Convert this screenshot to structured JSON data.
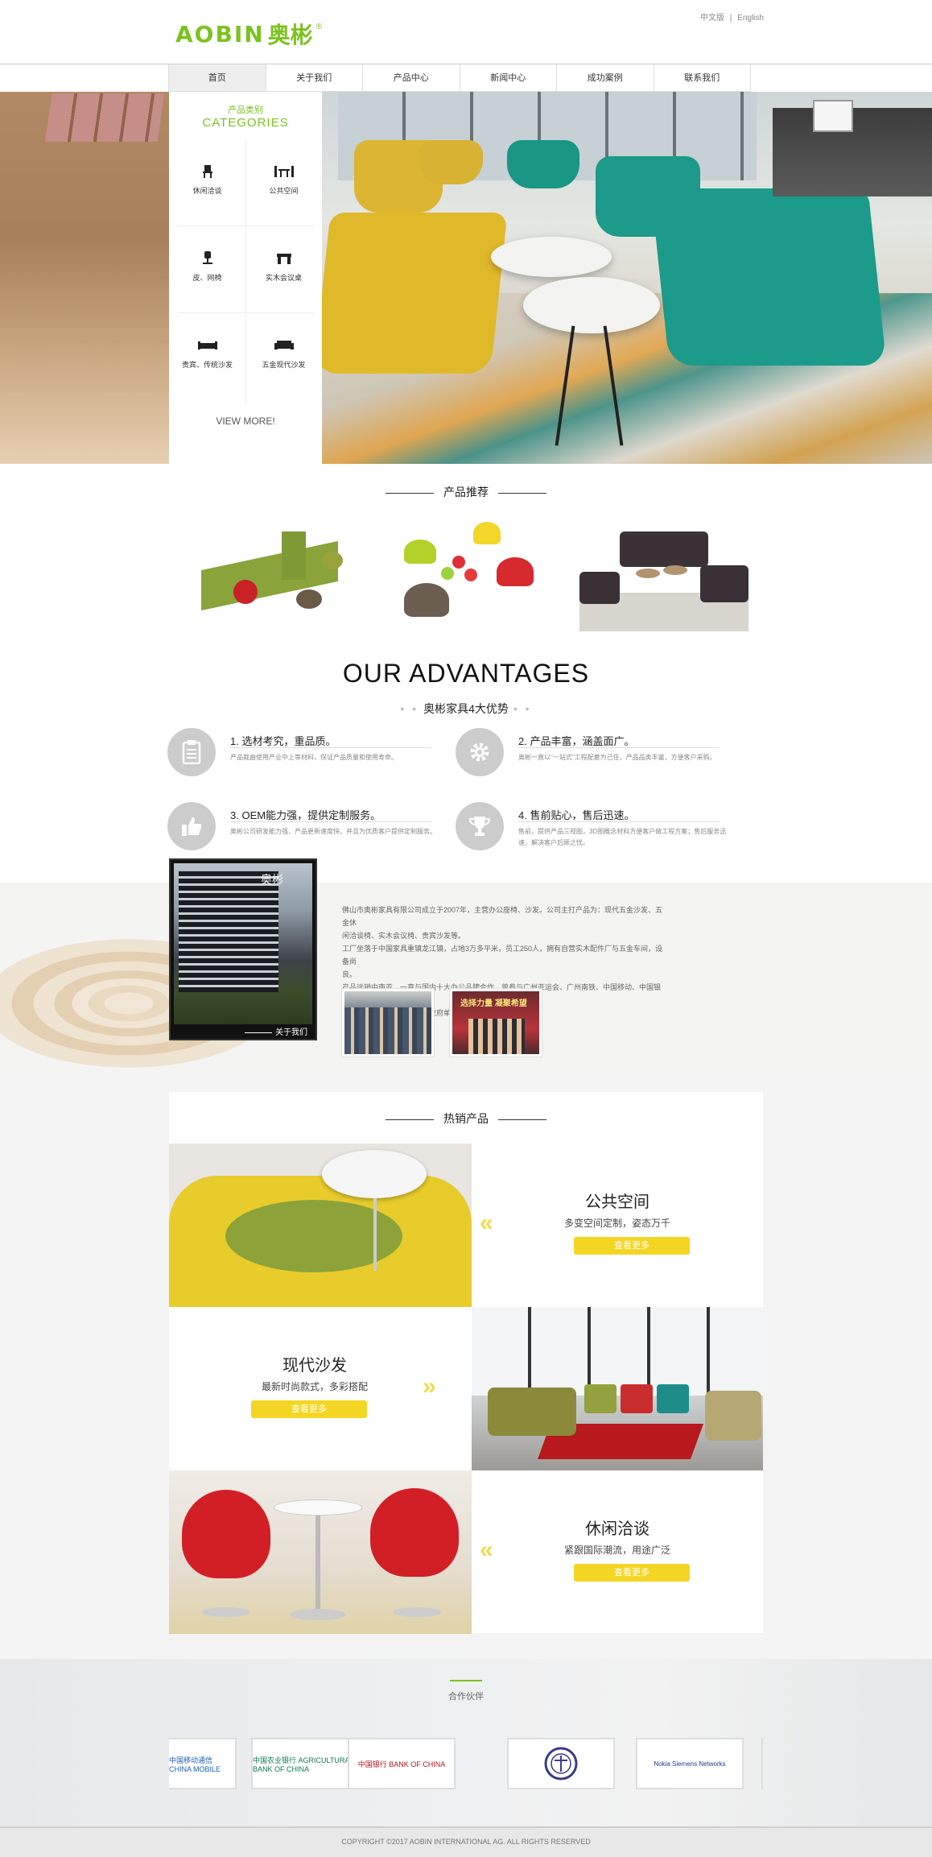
{
  "header": {
    "logo_en": "AOBIN",
    "logo_cn": "奥彬",
    "logo_reg": "®",
    "lang_cn": "中文版",
    "lang_sep": "|",
    "lang_en": "English"
  },
  "nav": {
    "items": [
      "首页",
      "关于我们",
      "产品中心",
      "新闻中心",
      "成功案例",
      "联系我们"
    ]
  },
  "categories": {
    "title_cn": "产品类别",
    "title_en": "CATEGORIES",
    "items": [
      "休闲洽谈",
      "公共空间",
      "皮、网椅",
      "实木会议桌",
      "贵宾、传统沙发",
      "五金现代沙发"
    ],
    "view_more": "VIEW MORE!"
  },
  "recommend": {
    "title": "产品推荐"
  },
  "advantages": {
    "title_en": "OUR ADVANTAGES",
    "title_cn": "奥彬家具4大优势",
    "dots": "• •",
    "items": [
      {
        "head": "1. 选材考究，重品质。",
        "desc": "产品裁曲使用产业中上等材料，保证产品质量和使用寿命。",
        "icon": "clipboard-icon"
      },
      {
        "head": "2. 产品丰富，涵盖面广。",
        "desc": "奥彬一直以\"一站式\"工程配套为己任，产品品类丰富，方便客户采购。",
        "icon": "gear-icon"
      },
      {
        "head": "3. OEM能力强，提供定制服务。",
        "desc": "奥彬公司研发能力强，产品更新速度快，并且为优质客户提供定制服务。",
        "icon": "thumbs-up-icon"
      },
      {
        "head": "4. 售前贴心，售后迅速。",
        "desc": "售前，提供产品三视图，3D图概念材料方便客户做工程方案；售后服务迅速，解决客户后顾之忧。",
        "icon": "trophy-icon"
      }
    ]
  },
  "about": {
    "building_sign": "奥彬",
    "link": "关于我们",
    "text": [
      "佛山市奥彬家具有限公司成立于2007年，主营办公座椅、沙发。公司主打产品为：现代五金沙发、五金休",
      "闲洽谈椅、实木会议椅、贵宾沙发等。",
      "工厂坐落于中国家具重镇龙江镇，占地3万多平米，员工250人，拥有自营实木配件厂与五金车间，设备尚",
      "良。",
      "产品远销中南亚，一直与国内十大办公品牌合作，曾参与广州亚运会、广州南铁、中国移动、中国银行、",
      "中信银行、农业银行等大型政府单位工程项目。"
    ],
    "banner_text": "选择力量 凝聚希望"
  },
  "hot": {
    "title": "热销产品",
    "items": [
      {
        "title": "公共空间",
        "sub": "多变空间定制，姿态万千",
        "btn": "查看更多"
      },
      {
        "title": "现代沙发",
        "sub": "最新时尚款式，多彩搭配",
        "btn": "查看更多"
      },
      {
        "title": "休闲洽谈",
        "sub": "紧跟国际潮流，用途广泛",
        "btn": "查看更多"
      }
    ],
    "chevron": "«"
  },
  "partners": {
    "title": "合作伙伴",
    "logos": [
      "中国移动通信 CHINA MOBILE",
      "中国农业银行 AGRICULTURAL BANK OF CHINA",
      "中国银行 BANK OF CHINA",
      "",
      "Nokia Siemens Networks"
    ]
  },
  "footer": {
    "text": "COPYRIGHT ©2017 AOBIN INTERNATIONAL AG. ALL RIGHTS RESERVED"
  },
  "colors": {
    "brand_green": "#7cc21f",
    "button_yellow": "#f3d624",
    "chevron_yellow": "#f1dc4d",
    "adv_icon_gray": "#cccccc"
  }
}
